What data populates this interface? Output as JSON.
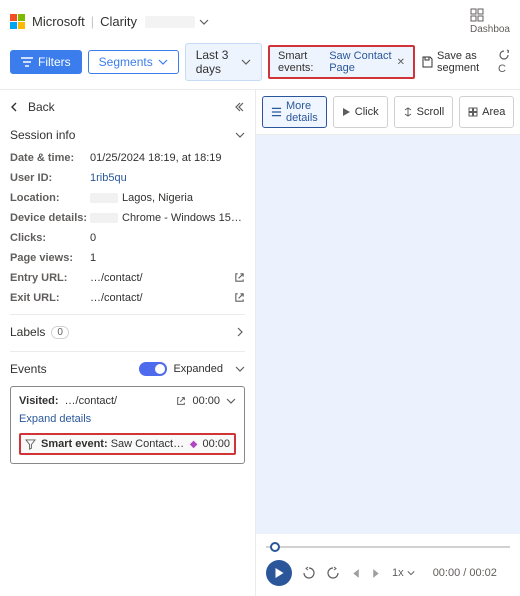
{
  "header": {
    "brand_ms": "Microsoft",
    "brand_clarity": "Clarity",
    "workspace": " ",
    "dashboard": "Dashboa"
  },
  "toolbar": {
    "filters": "Filters",
    "segments": "Segments",
    "date_range": "Last 3 days",
    "chip_label": "Smart events:",
    "chip_value": "Saw Contact Page",
    "save_segment": "Save as segment",
    "copy_label": "C"
  },
  "back": {
    "label": "Back"
  },
  "session": {
    "title": "Session info",
    "datetime_k": "Date & time:",
    "datetime_v": "01/25/2024 18:19, at 18:19",
    "userid_k": "User ID:",
    "userid_v": "1rib5qu",
    "location_k": "Location:",
    "location_v": "Lagos, Nigeria",
    "device_k": "Device details:",
    "device_v": "Chrome - Windows 15…",
    "clicks_k": "Clicks:",
    "clicks_v": "0",
    "views_k": "Page views:",
    "views_v": "1",
    "entry_k": "Entry URL:",
    "entry_v": "…/contact/",
    "exit_k": "Exit URL:",
    "exit_v": "…/contact/"
  },
  "labels": {
    "label": "Labels",
    "count": "0"
  },
  "events": {
    "title": "Events",
    "expanded": "Expanded",
    "visited_label": "Visited:",
    "visited_url": "…/contact/",
    "visited_time": "00:00",
    "expand_details": "Expand details",
    "smart_event_prefix": "Smart event:",
    "smart_event_name": "Saw Contact Pa…",
    "smart_event_time": "00:00"
  },
  "player": {
    "more_details": "More details",
    "click": "Click",
    "scroll": "Scroll",
    "area": "Area",
    "speed": "1x",
    "time_current": "00:00",
    "time_total": "00:02"
  }
}
